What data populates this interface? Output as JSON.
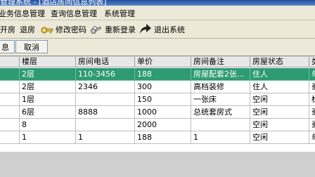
{
  "window": {
    "title": "管理系统 - [酒店房间信息列表]"
  },
  "menu": [
    "业务信息管理",
    "查询信息管理",
    "系统管理"
  ],
  "toolbar": {
    "open_room": "开房",
    "check_out": "退房",
    "change_password": "修改密码",
    "relogin": "重新登录",
    "exit_system": "退出系统"
  },
  "actions": {
    "info": "息",
    "cancel": "取消"
  },
  "table": {
    "columns": [
      "楼层",
      "房间电话",
      "单价",
      "房间备注",
      "房屋状态",
      "类"
    ],
    "rows": [
      [
        "2层",
        "110-3456",
        "188",
        "房屋配套2张...",
        "住人",
        "单"
      ],
      [
        "2层",
        "2346",
        "300",
        "高档装修",
        "住人",
        "豪"
      ],
      [
        "1层",
        "",
        "150",
        "一张床",
        "空闲",
        "标"
      ],
      [
        "6层",
        "8888",
        "1000",
        "总统套房式",
        "空闲",
        "豪"
      ],
      [
        "8",
        "",
        "2000",
        "",
        "空闲",
        "豪"
      ],
      [
        "1",
        "1",
        "188",
        "1",
        "空闲",
        "单"
      ]
    ],
    "selected_row": 0
  }
}
